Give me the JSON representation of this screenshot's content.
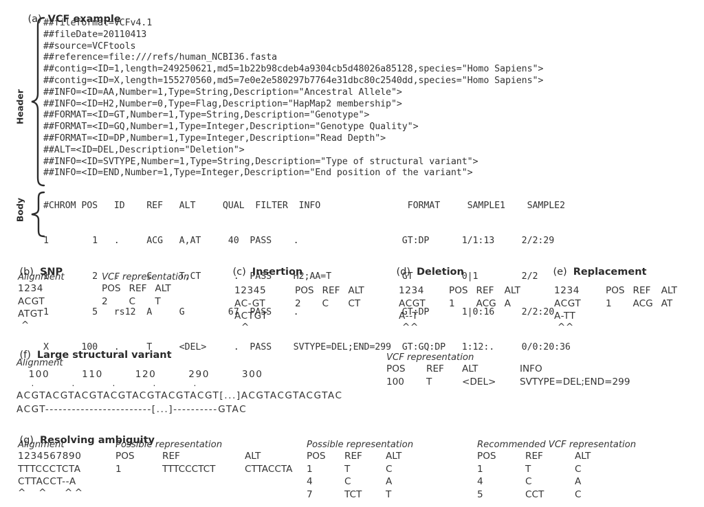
{
  "figure": {
    "panels": {
      "a": {
        "letter": "(a)",
        "title": "VCF example"
      },
      "b": {
        "letter": "(b)",
        "title": "SNP"
      },
      "c": {
        "letter": "(c)",
        "title": "Insertion"
      },
      "d": {
        "letter": "(d)",
        "title": "Deletion"
      },
      "e": {
        "letter": "(e)",
        "title": "Replacement"
      },
      "f": {
        "letter": "(f)",
        "title": "Large structural variant"
      },
      "g": {
        "letter": "(g)",
        "title": "Resolving ambiguity"
      }
    }
  },
  "panel_a": {
    "brace_labels": {
      "header": "Header",
      "body": "Body"
    },
    "header_lines": [
      "##fileformat=VCFv4.1",
      "##fileDate=20110413",
      "##source=VCFtools",
      "##reference=file:///refs/human_NCBI36.fasta",
      "##contig=<ID=1,length=249250621,md5=1b22b98cdeb4a9304cb5d48026a85128,species=\"Homo Sapiens\">",
      "##contig=<ID=X,length=155270560,md5=7e0e2e580297b7764e31dbc80c2540dd,species=\"Homo Sapiens\">",
      "##INFO=<ID=AA,Number=1,Type=String,Description=\"Ancestral Allele\">",
      "##INFO=<ID=H2,Number=0,Type=Flag,Description=\"HapMap2 membership\">",
      "##FORMAT=<ID=GT,Number=1,Type=String,Description=\"Genotype\">",
      "##FORMAT=<ID=GQ,Number=1,Type=Integer,Description=\"Genotype Quality\">",
      "##FORMAT=<ID=DP,Number=1,Type=Integer,Description=\"Read Depth\">",
      "##ALT=<ID=DEL,Description=\"Deletion\">",
      "##INFO=<ID=SVTYPE,Number=1,Type=String,Description=\"Type of structural variant\">",
      "##INFO=<ID=END,Number=1,Type=Integer,Description=\"End position of the variant\">"
    ],
    "column_header": "#CHROM POS   ID    REF   ALT     QUAL  FILTER  INFO                FORMAT     SAMPLE1    SAMPLE2",
    "body_rows": [
      "1        1   .     ACG   A,AT     40  PASS    .                   GT:DP      1/1:13     2/2:29",
      "1        2   .     C     T,CT      .  PASS    H2;AA=T             GT         0|1        2/2",
      "1        5   rs12  A     G        67  PASS    .                   GT:DP      1|0:16     2/2:20",
      "X      100   .     T     <DEL>     .  PASS    SVTYPE=DEL;END=299  GT:GQ:DP   1:12:.     0/0:20:36"
    ]
  },
  "panel_b": {
    "alignment_label": "Alignment",
    "vcf_label": "VCF representation",
    "alignment_lines": [
      "1234",
      "ACGT",
      "ATGT"
    ],
    "caret_line": " ^",
    "table_header": [
      "POS",
      "REF",
      "ALT"
    ],
    "table_rows": [
      [
        "2",
        "C",
        "T"
      ]
    ]
  },
  "panel_c": {
    "alignment_label": "",
    "vcf_label": "",
    "alignment_lines": [
      "12345",
      "AC-GT",
      "ACTGT"
    ],
    "caret_line": "  ^",
    "table_header": [
      "POS",
      "REF",
      "ALT"
    ],
    "table_rows": [
      [
        "2",
        "C",
        "CT"
      ]
    ]
  },
  "panel_d": {
    "alignment_lines": [
      "1234",
      "ACGT",
      "A--T"
    ],
    "caret_line": " ^^",
    "table_header": [
      "POS",
      "REF",
      "ALT"
    ],
    "table_rows": [
      [
        "1",
        "ACG",
        "A"
      ]
    ]
  },
  "panel_e": {
    "alignment_lines": [
      "1234",
      "ACGT",
      "A-TT"
    ],
    "caret_line": " ^^",
    "table_header": [
      "POS",
      "REF",
      "ALT"
    ],
    "table_rows": [
      [
        "1",
        "ACG",
        "AT"
      ]
    ]
  },
  "panel_f": {
    "alignment_label": "Alignment",
    "vcf_label": "VCF representation",
    "coord_line": "   100        110        120        290        300",
    "tick_line": "    .          .          .          .          .",
    "ref_line": "ACGTACGTACGTACGTACGTACGTACGT[...]ACGTACGTACGTAC",
    "alt_line": "ACGT------------------------[...]----------GTAC",
    "table_header": [
      "POS",
      "REF",
      "ALT",
      "INFO"
    ],
    "table_rows": [
      [
        "100",
        "T",
        "<DEL>",
        "SVTYPE=DEL;END=299"
      ]
    ]
  },
  "panel_g": {
    "alignment_label": "Alignment",
    "possible_label_1": "Possible representation",
    "possible_label_2": "Possible representation",
    "recommended_label": "Recommended VCF representation",
    "alignment_lines": [
      "1234567890",
      "TTTCCCTCTA",
      "CTTACCT--A"
    ],
    "caret_line": "^  ^   ^^",
    "possible_1": {
      "header": [
        "POS",
        "REF",
        "ALT"
      ],
      "rows": [
        [
          "1",
          "TTTCCCTCT",
          "CTTACCTA"
        ]
      ]
    },
    "possible_2": {
      "header": [
        "POS",
        "REF",
        "ALT"
      ],
      "rows": [
        [
          "1",
          "T",
          "C"
        ],
        [
          "4",
          "C",
          "A"
        ],
        [
          "7",
          "TCT",
          "T"
        ]
      ]
    },
    "recommended": {
      "header": [
        "POS",
        "REF",
        "ALT"
      ],
      "rows": [
        [
          "1",
          "T",
          "C"
        ],
        [
          "4",
          "C",
          "A"
        ],
        [
          "5",
          "CCT",
          "C"
        ]
      ]
    }
  },
  "colors": {
    "text": "#333333",
    "background": "#ffffff"
  }
}
